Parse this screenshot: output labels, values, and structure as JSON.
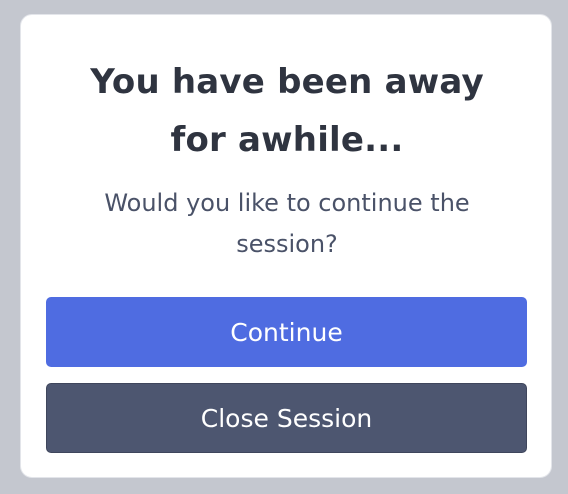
{
  "dialog": {
    "title": "You have been away for awhile...",
    "message": "Would you like to continue the session?",
    "actions": {
      "continue_label": "Continue",
      "close_label": "Close Session"
    }
  },
  "colors": {
    "overlay": "#c4c7cf",
    "dialog_background": "#ffffff",
    "primary_button": "#4f6ce1",
    "secondary_button": "#4d5670",
    "title_text": "#2f3440",
    "message_text": "#4a5268"
  }
}
